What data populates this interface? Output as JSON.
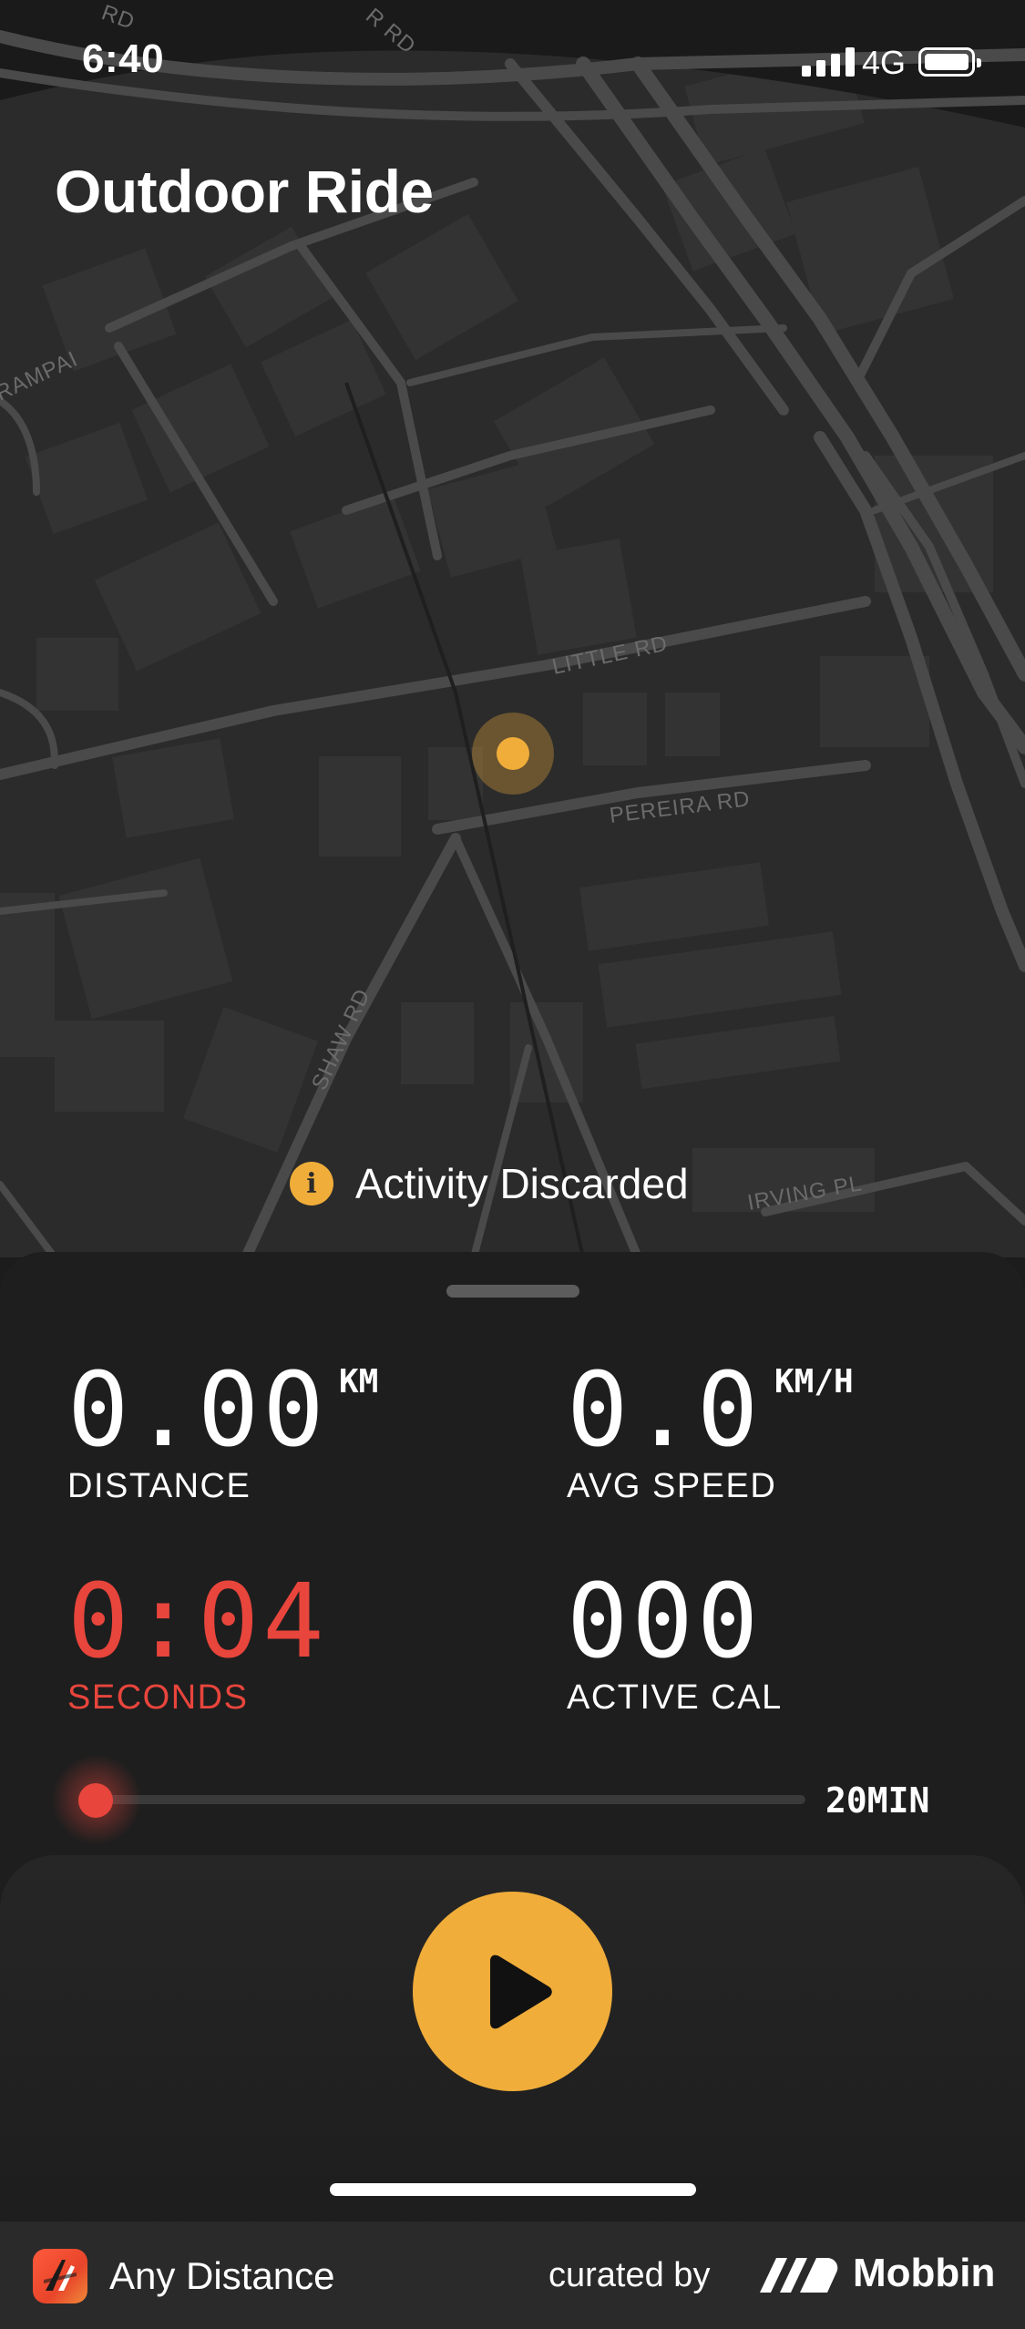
{
  "status_bar": {
    "time": "6:40",
    "network": "4G"
  },
  "page": {
    "title": "Outdoor Ride"
  },
  "map": {
    "street_labels": [
      "RD",
      "R RD",
      "RAMPAI",
      "LITTLE RD",
      "PEREIRA RD",
      "SHAW RD",
      "IRVING PL"
    ]
  },
  "toast": {
    "icon": "info-icon",
    "text": "Activity Discarded"
  },
  "metrics": {
    "distance": {
      "value": "0.00",
      "unit": "KM",
      "label": "DISTANCE"
    },
    "avg_speed": {
      "value": "0.0",
      "unit": "KM/H",
      "label": "AVG SPEED"
    },
    "time": {
      "value": "0:04",
      "label": "SECONDS"
    },
    "calories": {
      "value": "000",
      "label": "ACTIVE CAL"
    }
  },
  "progress": {
    "fraction": 0.0,
    "limit_label": "20MIN"
  },
  "controls": {
    "play_icon": "play-icon"
  },
  "colors": {
    "accent": "#f0ad3a",
    "timer_red": "#e8453c",
    "sheet": "#1e1e1e"
  },
  "footer": {
    "app_name": "Any Distance",
    "curated_by": "curated by",
    "brand": "Mobbin"
  }
}
